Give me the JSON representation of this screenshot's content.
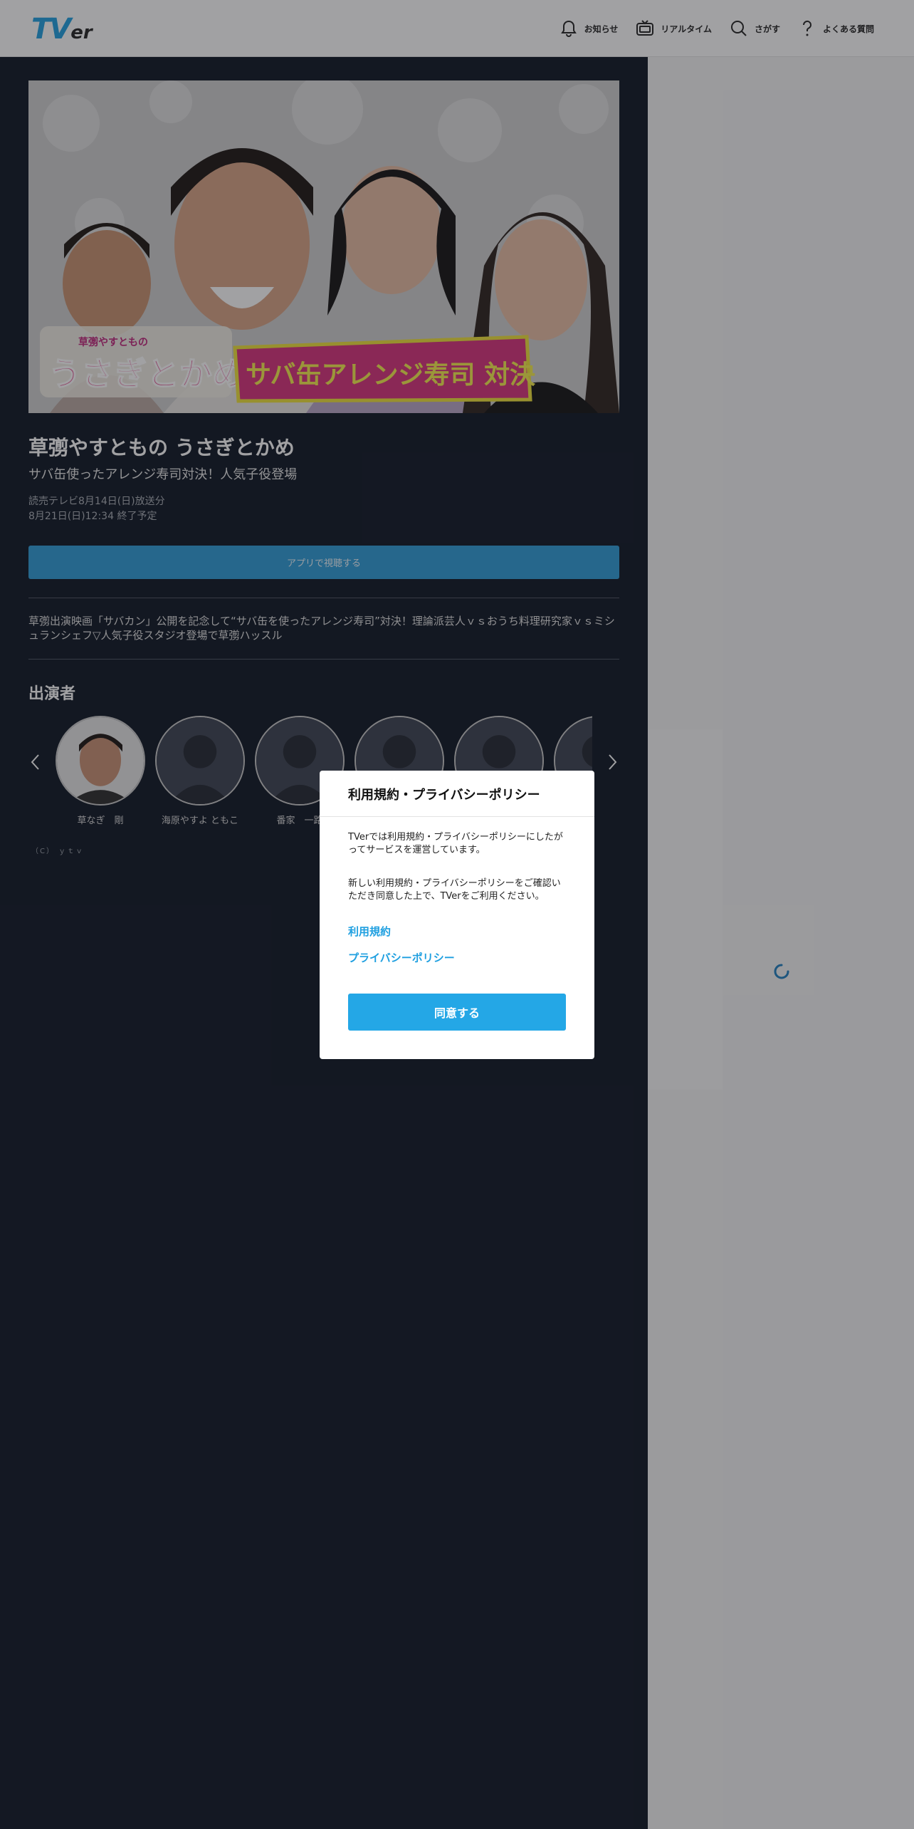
{
  "header": {
    "logo_main": "TV",
    "logo_sub": "er",
    "nav": [
      {
        "label": "お知らせ",
        "icon": "bell-icon"
      },
      {
        "label": "リアルタイム",
        "icon": "tv-icon"
      },
      {
        "label": "さがす",
        "icon": "search-icon"
      },
      {
        "label": "よくある質問",
        "icon": "question-icon"
      }
    ]
  },
  "episode": {
    "hero_logo_small": "草彅やすともの",
    "hero_logo_main": "うさぎとかめ",
    "hero_banner": "サバ缶アレンジ寿司 対決",
    "title": "草彅やすともの うさぎとかめ",
    "subtitle": "サバ缶使ったアレンジ寿司対決！人気子役登場",
    "broadcast": "読売テレビ8月14日(日)放送分",
    "expiry": "8月21日(日)12:34 終了予定",
    "watch_button": "アプリで視聴する",
    "description": "草彅出演映画「サバカン」公開を記念して“サバ缶を使ったアレンジ寿司”対決！理論派芸人ｖｓおうち料理研究家ｖｓミシュランシェフ▽人気子役スタジオ登場で草彅ハッスル"
  },
  "cast": {
    "heading": "出演者",
    "members": [
      {
        "name": "草なぎ　剛",
        "has_photo": true
      },
      {
        "name": "海原やすよ ともこ",
        "has_photo": false
      },
      {
        "name": "番家　一路",
        "has_photo": false
      },
      {
        "name": "",
        "has_photo": false
      },
      {
        "name": "",
        "has_photo": false
      },
      {
        "name": "",
        "has_photo": false
      }
    ]
  },
  "copyright": "（C） ｙｔｖ",
  "modal": {
    "title": "利用規約・プライバシーポリシー",
    "paragraph1": "TVerでは利用規約・プライバシーポリシーにしたがってサービスを運営しています。",
    "paragraph2": "新しい利用規約・プライバシーポリシーをご確認いただき同意した上で、TVerをご利用ください。",
    "link_terms": "利用規約",
    "link_privacy": "プライバシーポリシー",
    "agree_button": "同意する"
  },
  "colors": {
    "accent": "#24a7e6",
    "main_bg": "#0c1422",
    "banner_pink": "#d8307a",
    "banner_yellow": "#f0e238"
  }
}
